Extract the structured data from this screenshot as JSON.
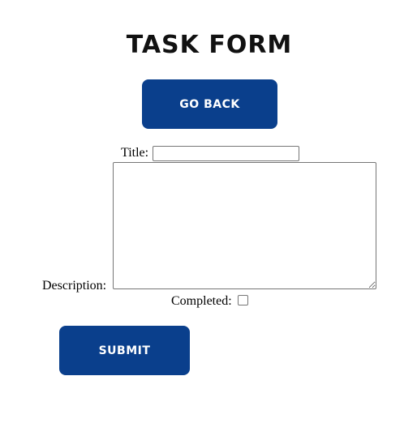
{
  "header": {
    "title": "TASK FORM"
  },
  "actions": {
    "back_label": "GO BACK",
    "submit_label": "SUBMIT"
  },
  "form": {
    "title_label": "Title:",
    "title_value": "",
    "description_label": "Description:",
    "description_value": "",
    "completed_label": "Completed:",
    "completed_checked": false
  },
  "colors": {
    "button_bg": "#0a3f8c",
    "button_text": "#ffffff"
  }
}
